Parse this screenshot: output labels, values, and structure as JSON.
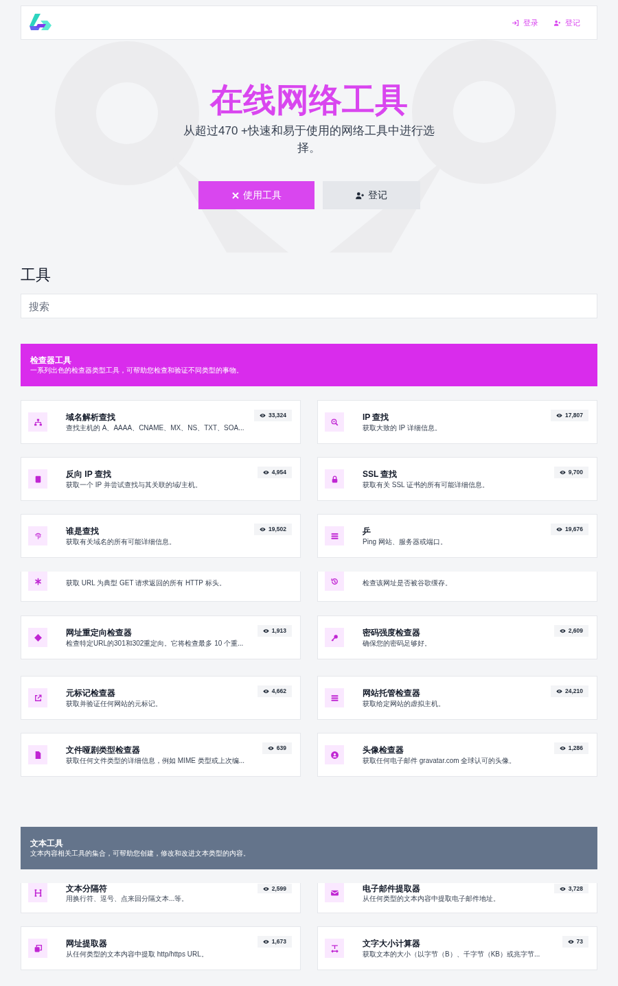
{
  "nav": {
    "links": [
      {
        "label": "登录"
      },
      {
        "label": "登记"
      }
    ]
  },
  "hero": {
    "title": "在线网络工具",
    "subtitle": "从超过470 +快速和易于使用的网络工具中进行选择。",
    "buttons": [
      {
        "label": "使用工具",
        "kind": "primary"
      },
      {
        "label": "登记",
        "kind": "secondary"
      }
    ]
  },
  "tools_heading": "工具",
  "search": {
    "placeholder": "搜索"
  },
  "sections": [
    {
      "title": "检查器工具",
      "description": "一系列出色的检查器类型工具，可帮助您检查和验证不同类型的事物。",
      "color": "#d92cec",
      "cards": [
        {
          "title": "域名解析查找",
          "description": "查找主机的 A、AAAA、CNAME、MX、NS、TXT、SOA...",
          "views": "33,324",
          "cropped": false
        },
        {
          "title": "IP 查找",
          "description": "获取大致的 IP 详细信息。",
          "views": "17,807",
          "cropped": false
        },
        {
          "title": "反向 IP 查找",
          "description": "获取一个 IP 并尝试查找与其关联的域/主机。",
          "views": "4,954",
          "cropped": false
        },
        {
          "title": "SSL 查找",
          "description": "获取有关 SSL 证书的所有可能详细信息。",
          "views": "9,700",
          "cropped": false
        },
        {
          "title": "谁是查找",
          "description": "获取有关域名的所有可能详细信息。",
          "views": "19,502",
          "cropped": false
        },
        {
          "title": "乒",
          "description": "Ping 网站、服务器或端口。",
          "views": "19,676",
          "cropped": false
        },
        {
          "description": "获取 URL 为典型 GET 请求返回的所有 HTTP 标头。",
          "cropped": true
        },
        {
          "description": "检查该网址是否被谷歌缓存。",
          "cropped": true
        },
        {
          "title": "网址重定向检查器",
          "description": "检查特定URL的301和302重定向。它将检查最多 10 个重...",
          "views": "1,913",
          "cropped": false
        },
        {
          "title": "密码强度检查器",
          "description": "确保您的密码足够好。",
          "views": "2,609",
          "cropped": false
        },
        {
          "title": "元标记检查器",
          "description": "获取并验证任何网站的元标记。",
          "views": "4,662",
          "cropped": false
        },
        {
          "title": "网站托管检查器",
          "description": "获取给定网站的虚拟主机。",
          "views": "24,210",
          "cropped": false
        },
        {
          "title": "文件哑剧类型检查器",
          "description": "获取任何文件类型的详细信息，例如 MIME 类型或上次编...",
          "views": "639",
          "cropped": false
        },
        {
          "title": "头像检查器",
          "description": "获取任何电子邮件 gravatar.com 全球认可的头像。",
          "views": "1,286",
          "cropped": false
        }
      ]
    },
    {
      "title": "文本工具",
      "description": "文本内容相关工具的集合，可帮助您创建，修改和改进文本类型的内容。",
      "color": "#64748b",
      "cards": [
        {
          "title": "文本分隔符",
          "description": "用换行符、逗号、点来回分隔文本...等。",
          "views": "2,599",
          "cropped": true
        },
        {
          "title": "电子邮件提取器",
          "description": "从任何类型的文本内容中提取电子邮件地址。",
          "views": "3,728",
          "cropped": true
        },
        {
          "title": "网址提取器",
          "description": "从任何类型的文本内容中提取 http/https URL。",
          "views": "1,673",
          "cropped": false
        },
        {
          "title": "文字大小计算器",
          "description": "获取文本的大小（以字节（B）、千字节（KB）或兆字节...",
          "views": "73",
          "cropped": false
        }
      ]
    }
  ]
}
